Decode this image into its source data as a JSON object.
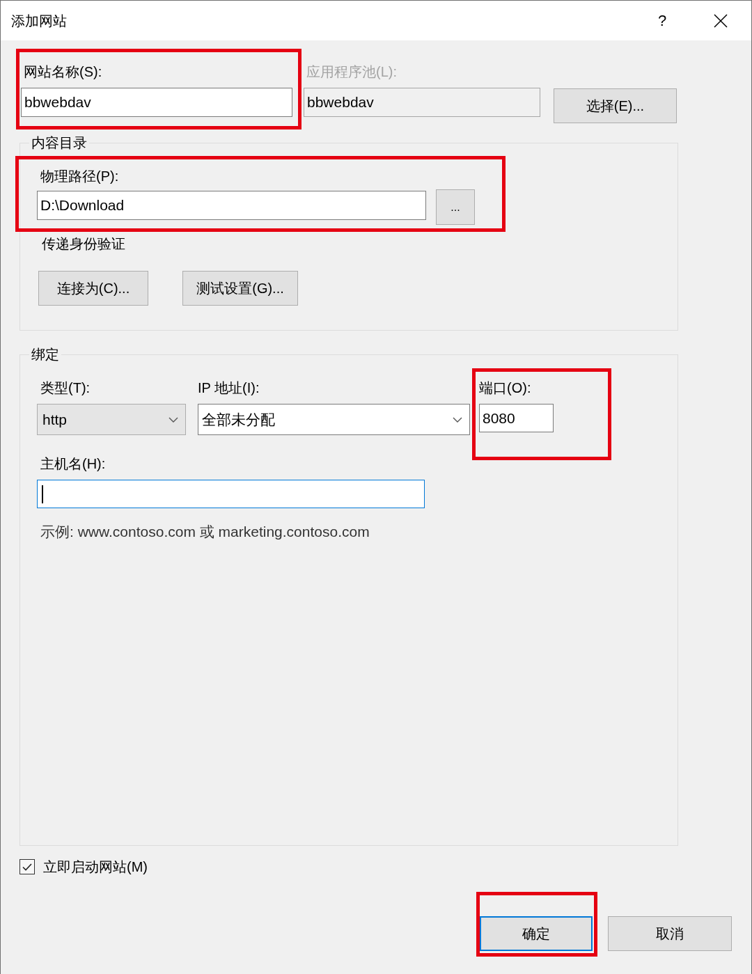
{
  "window": {
    "title": "添加网站",
    "help_button": "?"
  },
  "site_name": {
    "label": "网站名称(S):",
    "value": "bbwebdav",
    "highlighted": true
  },
  "app_pool": {
    "label": "应用程序池(L):",
    "value": "bbwebdav",
    "disabled": true,
    "button": "选择(E)..."
  },
  "content_directory": {
    "title": "内容目录",
    "physical_path": {
      "label": "物理路径(P):",
      "value": "D:\\Download",
      "browse_button": "...",
      "highlighted": true
    },
    "pass_through_auth": {
      "label": "传递身份验证",
      "buttons": [
        "连接为(C)...",
        "测试设置(G)..."
      ]
    }
  },
  "binding": {
    "title": "绑定",
    "type": {
      "label": "类型(T):",
      "value": "http",
      "editable": false
    },
    "ip_address": {
      "label": "IP 地址(I):",
      "value": "全部未分配",
      "editable": true
    },
    "port": {
      "label": "端口(O):",
      "value": "8080",
      "highlighted": true
    },
    "host_name": {
      "label": "主机名(H):",
      "focused": true
    },
    "example": "示例: www.contoso.com 或 marketing.contoso.com"
  },
  "start_immediately": {
    "label": "立即启动网站(M)",
    "checked": true
  },
  "buttons": [
    {
      "label": "确定",
      "default": true,
      "highlighted": true
    },
    {
      "label": "取消",
      "default": false,
      "highlighted": false
    }
  ]
}
